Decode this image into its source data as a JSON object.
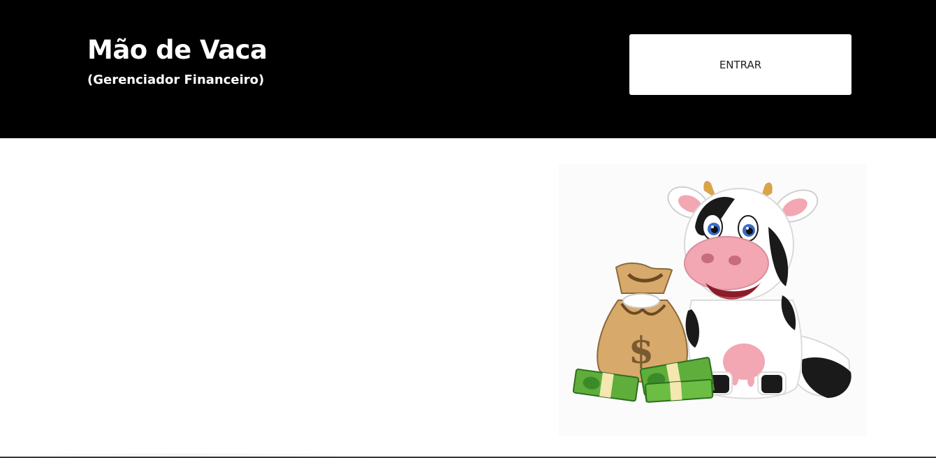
{
  "header": {
    "title": "Mão de Vaca",
    "subtitle": "(Gerenciador Financeiro)",
    "login_label": "ENTRAR"
  },
  "hero": {
    "illustration": "cartoon-cow-with-money-bag-and-cash",
    "money_symbol": "$"
  },
  "colors": {
    "header_background": "#000000",
    "header_text": "#ffffff",
    "button_background": "#ffffff",
    "button_text": "#222222",
    "page_background": "#ffffff"
  }
}
